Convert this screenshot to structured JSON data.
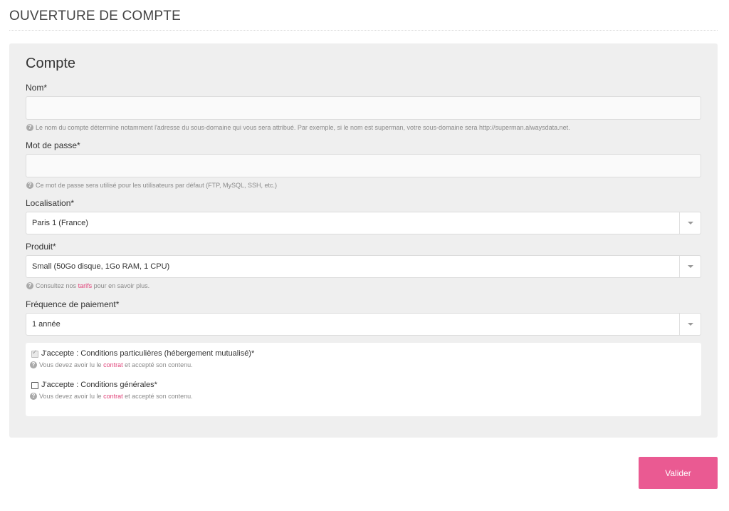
{
  "page": {
    "title": "OUVERTURE DE COMPTE"
  },
  "section": {
    "title": "Compte"
  },
  "fields": {
    "name": {
      "label": "Nom*",
      "value": "",
      "help": "Le nom du compte détermine notamment l'adresse du sous-domaine qui vous sera attribué. Par exemple, si le nom est superman, votre sous-domaine sera http://superman.alwaysdata.net."
    },
    "password": {
      "label": "Mot de passe*",
      "value": "",
      "help": "Ce mot de passe sera utilisé pour les utilisateurs par défaut (FTP, MySQL, SSH, etc.)"
    },
    "location": {
      "label": "Localisation*",
      "selected": "Paris 1 (France)"
    },
    "product": {
      "label": "Produit*",
      "selected": "Small (50Go disque, 1Go RAM, 1 CPU)",
      "help_before": "Consultez nos",
      "help_link": "tarifs",
      "help_after": "pour en savoir plus."
    },
    "frequency": {
      "label": "Fréquence de paiement*",
      "selected": "1 année"
    }
  },
  "terms": [
    {
      "label": "J'accepte : Conditions particulières (hébergement mutualisé)*",
      "checked": true,
      "help_before": "Vous devez avoir lu le",
      "help_link": "contrat",
      "help_after": "et accepté son contenu."
    },
    {
      "label": "J'accepte : Conditions générales*",
      "checked": false,
      "help_before": "Vous devez avoir lu le",
      "help_link": "contrat",
      "help_after": "et accepté son contenu."
    }
  ],
  "actions": {
    "submit_label": "Valider"
  },
  "icons": {
    "help": "question-circle-icon",
    "dropdown": "caret-down-icon",
    "check": "checkmark-icon"
  },
  "colors": {
    "accent": "#ea5a92",
    "link": "#e0457b",
    "panel": "#efefef"
  }
}
